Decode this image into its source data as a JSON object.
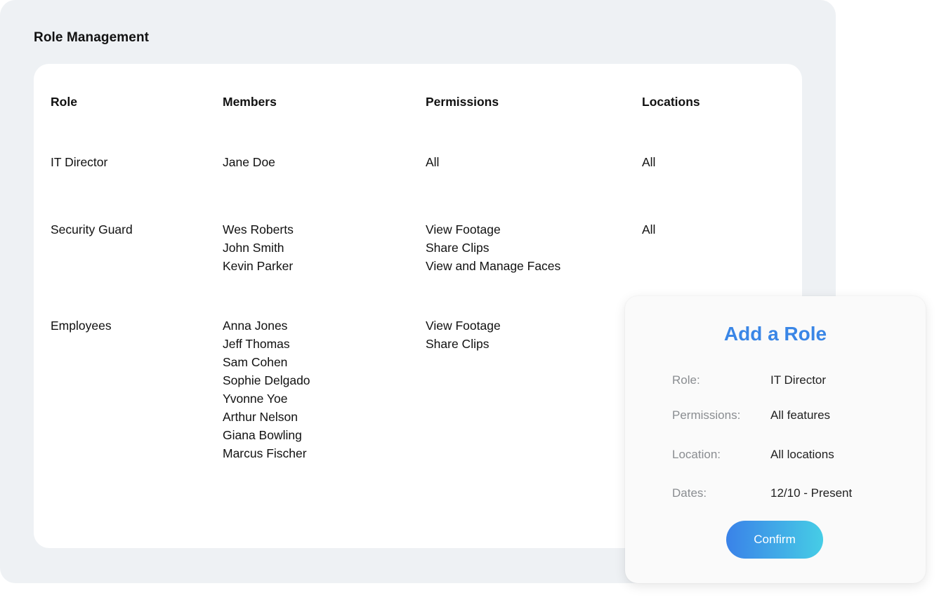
{
  "panel": {
    "title": "Role Management"
  },
  "table": {
    "headers": {
      "role": "Role",
      "members": "Members",
      "permissions": "Permissions",
      "locations": "Locations"
    },
    "rows": [
      {
        "role": "IT Director",
        "members": [
          "Jane Doe"
        ],
        "permissions": [
          "All"
        ],
        "locations": [
          "All"
        ]
      },
      {
        "role": "Security Guard",
        "members": [
          "Wes Roberts",
          "John Smith",
          "Kevin Parker"
        ],
        "permissions": [
          "View Footage",
          "Share Clips",
          "View and Manage Faces"
        ],
        "locations": [
          "All"
        ]
      },
      {
        "role": "Employees",
        "members": [
          "Anna Jones",
          "Jeff Thomas",
          "Sam Cohen",
          "Sophie Delgado",
          "Yvonne Yoe",
          "Arthur Nelson",
          "Giana Bowling",
          "Marcus Fischer"
        ],
        "permissions": [
          "View Footage",
          "Share Clips"
        ],
        "locations": []
      }
    ]
  },
  "modal": {
    "title": "Add a Role",
    "fields": [
      {
        "label": "Role:",
        "value": "IT Director"
      },
      {
        "label": "Permissions:",
        "value": "All features"
      },
      {
        "label": "Location:",
        "value": "All locations"
      },
      {
        "label": "Dates:",
        "value": "12/10 - Present"
      }
    ],
    "confirm_label": "Confirm"
  },
  "colors": {
    "panel_bg": "#eef1f4",
    "accent": "#3a86e6",
    "button_gradient_start": "#3a82e8",
    "button_gradient_end": "#46cde6"
  }
}
